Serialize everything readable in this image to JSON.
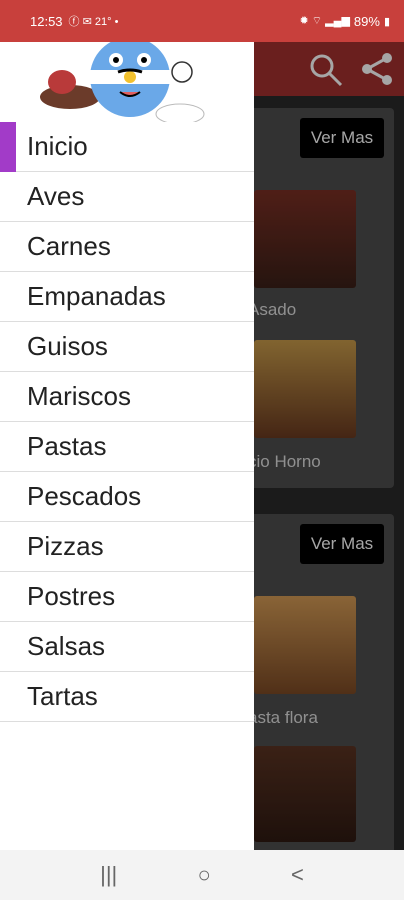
{
  "status_bar": {
    "time": "12:53",
    "left_icons": "ⓕ ✉ 21° •",
    "battery": "89%"
  },
  "app_bar": {
    "search_icon": "search-icon",
    "share_icon": "share-icon"
  },
  "content": {
    "sections": [
      {
        "button": "Ver Mas",
        "items": [
          "Asado",
          "cio Horno"
        ]
      },
      {
        "button": "Ver Mas",
        "items": [
          "asta flora",
          ""
        ]
      }
    ]
  },
  "drawer": {
    "menu": [
      "Inicio",
      "Aves",
      "Carnes",
      "Empanadas",
      "Guisos",
      "Mariscos",
      "Pastas",
      "Pescados",
      "Pizzas",
      "Postres",
      "Salsas",
      "Tartas"
    ]
  },
  "nav": {
    "recents": "|||",
    "home": "○",
    "back": "<"
  }
}
